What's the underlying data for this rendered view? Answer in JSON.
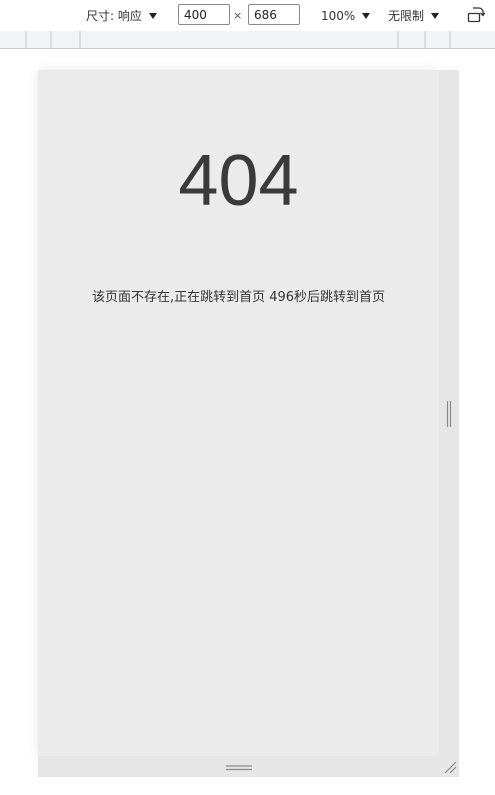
{
  "toolbar": {
    "dimensions_label": "尺寸: 响应",
    "width_value": "400",
    "times_sign": "×",
    "height_value": "686",
    "zoom_label": "100%",
    "throttle_label": "无限制",
    "rotate_icon": "rotate-device-icon"
  },
  "page": {
    "error_code": "404",
    "message": "该页面不存在,正在跳转到首页",
    "countdown_seconds": "496",
    "countdown_suffix": "秒后跳转到首页"
  },
  "colors": {
    "viewport_bg": "#ebebeb",
    "error_text": "#3a3a3a",
    "ruler_bg": "#dadce0"
  }
}
